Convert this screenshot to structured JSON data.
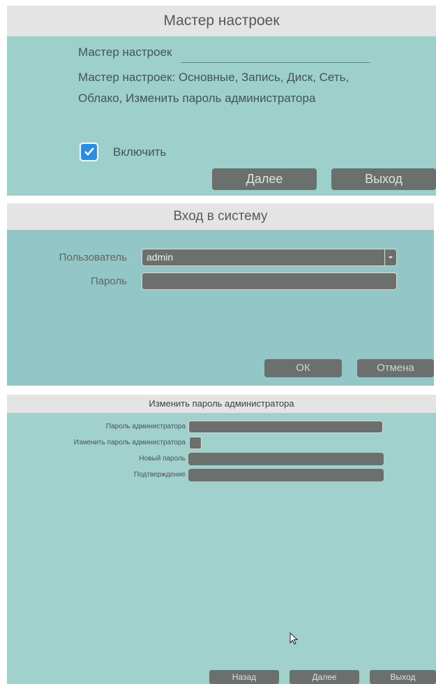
{
  "wizard": {
    "title": "Мастер настроек",
    "heading": "Мастер настроек",
    "description": "Мастер настроек: Основные, Запись, Диск, Сеть, Облако, Изменить пароль администратора",
    "enable_label": "Включить",
    "enable_checked": true,
    "next_label": "Далее",
    "exit_label": "Выход"
  },
  "login": {
    "title": "Вход в систему",
    "user_label": "Пользователь",
    "user_value": "admin",
    "password_label": "Пароль",
    "password_value": "",
    "ok_label": "ОК",
    "cancel_label": "Отмена"
  },
  "change_password": {
    "title": "Изменить пароль администратора",
    "admin_password_label": "Пароль администратора",
    "change_admin_password_label": "Изменить пароль администратора",
    "new_password_label": "Новый пароль",
    "confirm_label": "Подтверждение",
    "back_label": "Назад",
    "next_label": "Далее",
    "exit_label": "Выход"
  },
  "colors": {
    "panel_background": "#9dcfcb",
    "button_background": "#6b706c",
    "checkbox_accent": "#2a8ee2"
  }
}
